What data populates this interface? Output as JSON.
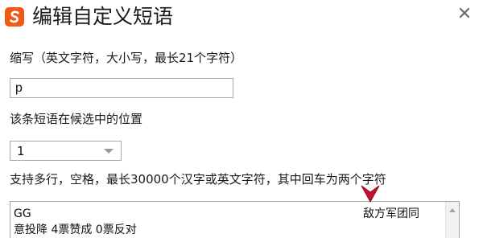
{
  "dialog": {
    "title": "编辑自定义短语",
    "logo_letter": "S",
    "close_label": "×"
  },
  "abbreviation": {
    "label": "缩写（英文字符，大小写，最长21个字符）",
    "value": "p"
  },
  "position": {
    "label": "该条短语在候选中的位置",
    "selected": "1"
  },
  "content": {
    "label": "支持多行，空格，最长30000个汉字或英文字符，其中回车为两个字符",
    "lines": [
      "GG",
      "意投降 4票赞成 0票反对"
    ],
    "right_note": "敌方军团同"
  },
  "colors": {
    "logo": "#ef5b17",
    "annotation_arrow": "#c8102e"
  },
  "icons": {
    "logo": "sogou-logo-icon",
    "close": "close-icon",
    "dropdown": "chevron-down-icon",
    "annotation": "red-arrow-icon"
  }
}
